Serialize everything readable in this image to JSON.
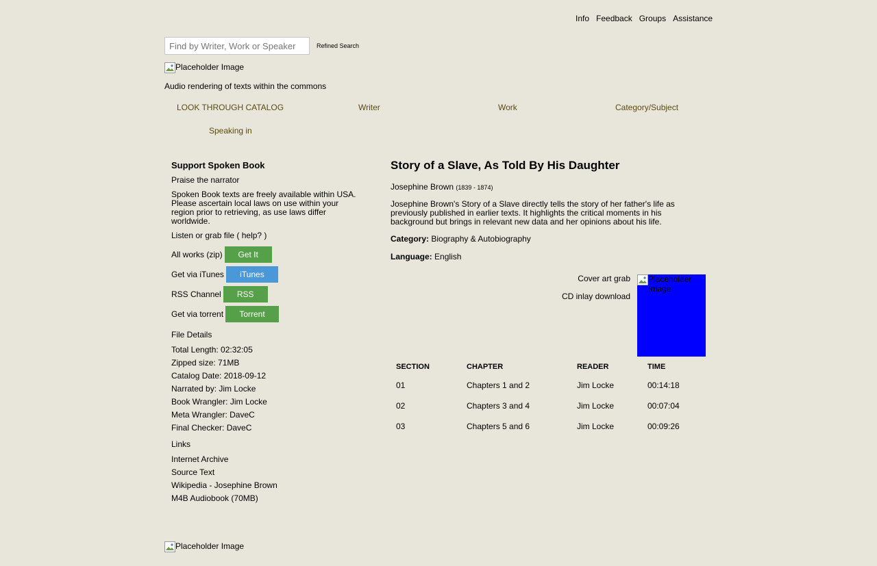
{
  "top_nav": [
    "Info",
    "Feedback",
    "Groups",
    "Assistance"
  ],
  "search": {
    "placeholder": "Find by Writer, Work or Speaker",
    "refined_label": "Refined Search"
  },
  "logo_alt": "Placeholder Image",
  "tagline": "Audio rendering of texts within the commons",
  "catalog_nav": [
    "LOOK THROUGH CATALOG",
    "Writer",
    "Work",
    "Category/Subject",
    "Speaking in"
  ],
  "sidebar": {
    "title": "Support Spoken Book",
    "praise": "Praise the narrator",
    "notice": "Spoken Book texts are freely available within USA. Please ascertain local laws on use within your region prior to retrieving, as use laws differ worldwide.",
    "listen": "Listen or grab file ( help? )",
    "downloads": [
      {
        "label": "All works (zip)",
        "button": "Get It",
        "color": "green"
      },
      {
        "label": "Get via iTunes",
        "button": "iTunes",
        "color": "blue"
      },
      {
        "label": "RSS Channel",
        "button": "RSS",
        "color": "green"
      },
      {
        "label": "Get via torrent",
        "button": "Torrent",
        "color": "green"
      }
    ],
    "file_details_heading": "File Details",
    "file_details": [
      "Total Length: 02:32:05",
      "Zipped size: 71MB",
      "Catalog Date: 2018-09-12",
      "Narrated by: Jim Locke",
      "Book Wrangler: Jim Locke",
      "Meta Wrangler: DaveC",
      "Final Checker: DaveC"
    ],
    "links_heading": "Links",
    "links": [
      "Internet Archive",
      "Source Text",
      "Wikipedia - Josephine Brown",
      "M4B Audiobook (70MB)"
    ]
  },
  "book": {
    "title": "Story of a Slave, As Told By His Daughter",
    "author": "Josephine Brown",
    "author_dates": "(1839 - 1874)",
    "description": "Josephine Brown's Story of a Slave directly tells the story of her father's life as previously published in earlier texts. It highlights the critical moments in his background but brings in relevant new data and her opinions about his life.",
    "category_label": "Category:",
    "category": "Biography & Autobiography",
    "language_label": "Language:",
    "language": "English",
    "cover_art_link": "Cover art grab",
    "cd_inlay_link": "CD inlay download",
    "cover_alt": "Placeholder Image",
    "cover_color": "#0000ff"
  },
  "table": {
    "headers": [
      "SECTION",
      "CHAPTER",
      "READER",
      "TIME"
    ],
    "rows": [
      [
        "01",
        "Chapters 1 and 2",
        "Jim Locke",
        "00:14:18"
      ],
      [
        "02",
        "Chapters 3 and 4",
        "Jim Locke",
        "00:07:04"
      ],
      [
        "03",
        "Chapters 5 and 6",
        "Jim Locke",
        "00:09:26"
      ]
    ]
  },
  "footer_alt": "Placeholder Image"
}
